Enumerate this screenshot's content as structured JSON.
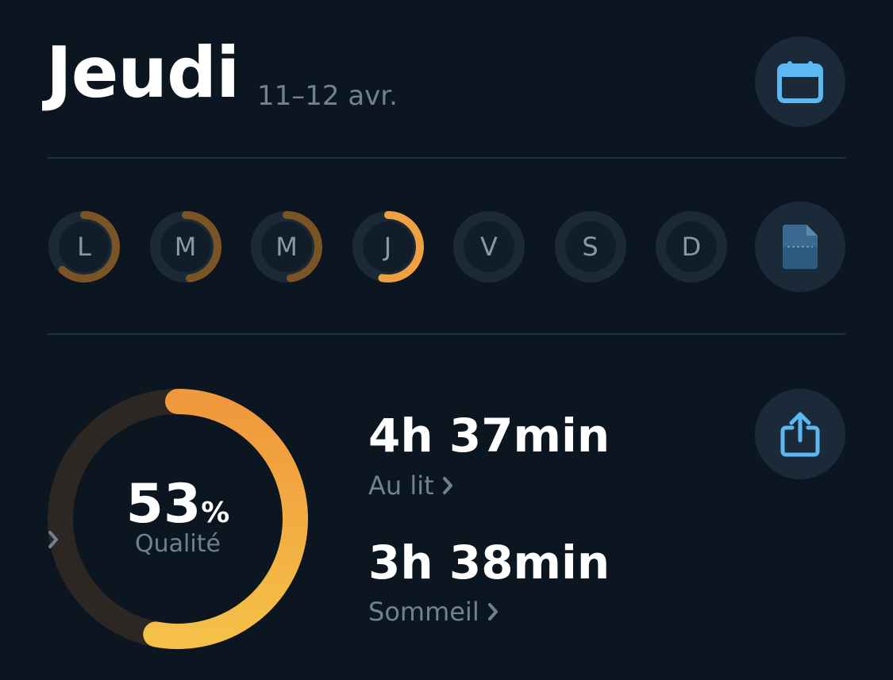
{
  "header": {
    "day_title": "Jeudi",
    "date_range": "11–12 avr."
  },
  "icons": {
    "calendar": "calendar-icon",
    "report": "document-icon",
    "share": "share-icon",
    "chevron": "chevron-right-icon"
  },
  "week": {
    "days": [
      {
        "letter": "L",
        "progress": 0.62,
        "state": "past"
      },
      {
        "letter": "M",
        "progress": 0.48,
        "state": "past"
      },
      {
        "letter": "M",
        "progress": 0.48,
        "state": "past"
      },
      {
        "letter": "J",
        "progress": 0.53,
        "state": "selected"
      },
      {
        "letter": "V",
        "progress": 0,
        "state": "future"
      },
      {
        "letter": "S",
        "progress": 0,
        "state": "future"
      },
      {
        "letter": "D",
        "progress": 0,
        "state": "future"
      }
    ]
  },
  "quality": {
    "value": "53",
    "unit": "%",
    "label": "Qualité",
    "fraction": 0.53
  },
  "stats": {
    "in_bed_value": "4h 37min",
    "in_bed_label": "Au lit",
    "sleep_value": "3h 38min",
    "sleep_label": "Sommeil"
  },
  "colors": {
    "background": "#0b1620",
    "button_bg": "#1a2a39",
    "accent_blue": "#5bb8f0",
    "orange": "#f0a040",
    "orange_dim": "#7a5424",
    "track": "#1c2a37",
    "gauge_track": "#2c2722",
    "muted_text": "#6f8192"
  }
}
